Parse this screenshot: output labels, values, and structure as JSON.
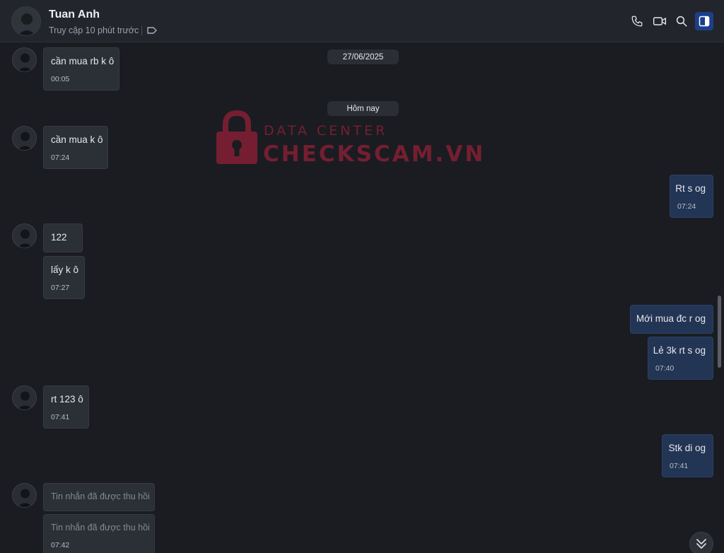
{
  "header": {
    "name": "Tuan Anh",
    "status": "Truy cập 10 phút trước",
    "icons": [
      "tag-icon",
      "phone-icon",
      "video-icon",
      "search-icon",
      "sidebar-toggle-icon"
    ]
  },
  "watermark": {
    "line1": "DATA CENTER",
    "line2": "CHECKSCAM.VN"
  },
  "dates": {
    "first": "27/06/2025",
    "today": "Hôm nay"
  },
  "messages": [
    {
      "dir": "in",
      "text": "cần mua rb k ô",
      "time": "00:05"
    },
    {
      "dir": "in",
      "text": "cần mua k ô",
      "time": "07:24"
    },
    {
      "dir": "out",
      "text": "Rt s og",
      "time": "07:24"
    },
    {
      "dir": "in",
      "text": "122",
      "time": ""
    },
    {
      "dir": "in",
      "text": "lấy k ô",
      "time": "07:27"
    },
    {
      "dir": "out",
      "text": "Mới mua đc r og",
      "time": ""
    },
    {
      "dir": "out",
      "text": "Lẻ 3k rt s og",
      "time": "07:40"
    },
    {
      "dir": "in",
      "text": "rt 123 ô",
      "time": "07:41"
    },
    {
      "dir": "out",
      "text": "Stk di og",
      "time": "07:41"
    },
    {
      "dir": "in",
      "text": "Tin nhắn đã được thu hồi",
      "time": ""
    },
    {
      "dir": "in",
      "text": "Tin nhắn đã được thu hồi",
      "time": "07:42"
    }
  ],
  "colors": {
    "background": "#1a1c21",
    "incoming_bubble": "#2b2f36",
    "outgoing_bubble": "#233554",
    "active_icon_bg": "#1d3f8a",
    "watermark": "#7a1f32"
  }
}
